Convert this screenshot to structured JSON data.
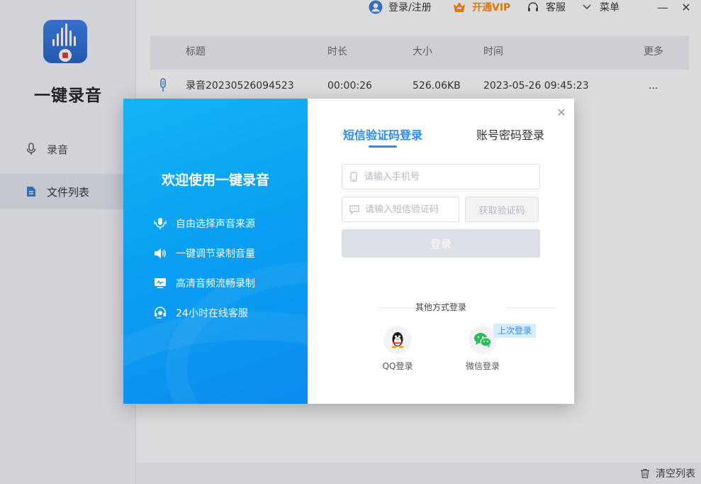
{
  "app": {
    "title": "一键录音"
  },
  "sidebar": {
    "items": [
      {
        "label": "录音",
        "icon": "microphone-icon"
      },
      {
        "label": "文件列表",
        "icon": "document-icon",
        "active": true
      }
    ]
  },
  "topbar": {
    "login_label": "登录/注册",
    "vip_label": "开通VIP",
    "service_label": "客服",
    "menu_label": "菜单",
    "minimize_symbol": "—",
    "close_symbol": "✕"
  },
  "table": {
    "columns": [
      "标题",
      "时长",
      "大小",
      "时间",
      "更多"
    ],
    "rows": [
      {
        "title": "录音20230526094523",
        "duration": "00:00:26",
        "size": "526.06KB",
        "time": "2023-05-26 09:45:23",
        "more": "..."
      }
    ]
  },
  "bottombar": {
    "clear_label": "清空列表"
  },
  "modal": {
    "welcome": "欢迎使用一键录音",
    "features": [
      {
        "label": "自由选择声音来源",
        "icon": "mic-wave-icon"
      },
      {
        "label": "一键调节录制音量",
        "icon": "speaker-icon"
      },
      {
        "label": "高清音频流畅录制",
        "icon": "monitor-icon"
      },
      {
        "label": "24小时在线客服",
        "icon": "headset-icon"
      }
    ],
    "tabs": [
      "短信验证码登录",
      "账号密码登录"
    ],
    "active_tab": 0,
    "phone_placeholder": "请输入手机号",
    "code_placeholder": "请输入短信验证码",
    "get_code_label": "获取验证码",
    "login_label": "登录",
    "other_label": "其他方式登录",
    "qq_label": "QQ登录",
    "wechat_label": "微信登录",
    "last_login_badge": "上次登录",
    "close_symbol": "✕"
  },
  "colors": {
    "accent": "#2a8af5",
    "vip": "#ff8a00",
    "modal_gradient_start": "#13b4f5",
    "modal_gradient_end": "#0b8df0"
  }
}
